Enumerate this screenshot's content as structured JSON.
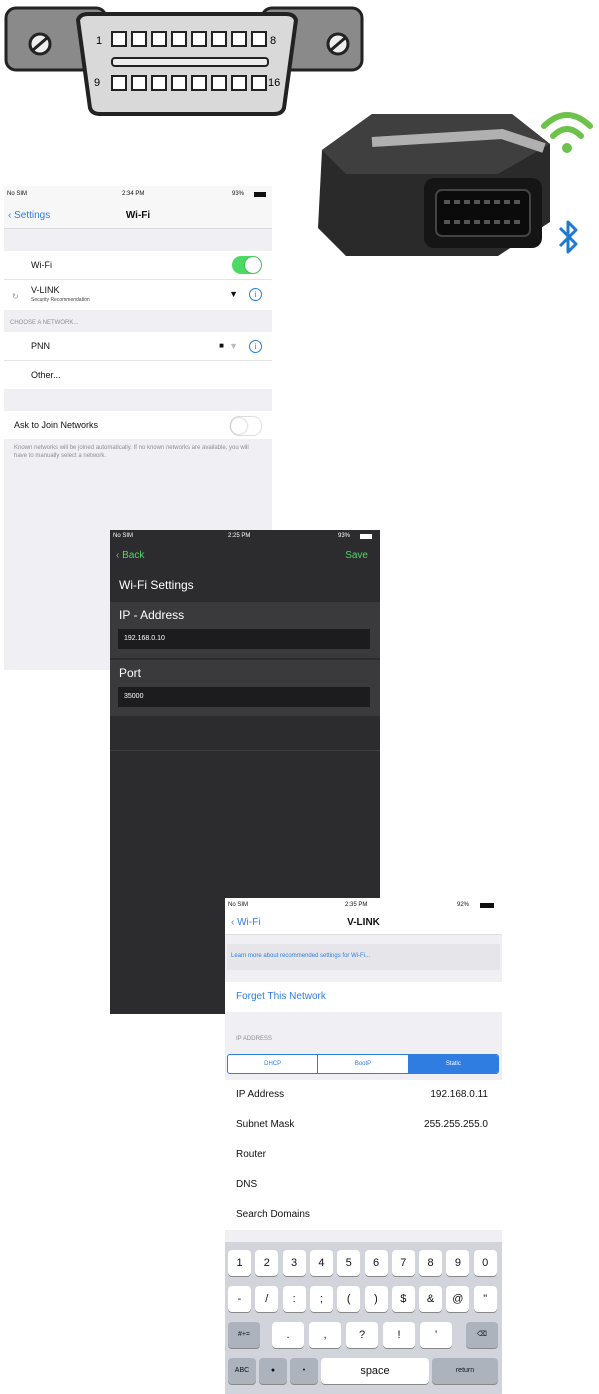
{
  "obd_port": {
    "pin_labels": {
      "p1": "1",
      "p8": "8",
      "p9": "9",
      "p16": "16"
    }
  },
  "device_icons": {
    "wifi": "wifi-icon",
    "bluetooth": "bluetooth-icon",
    "wifi_color": "#6cc24a",
    "bluetooth_color": "#1f78d1"
  },
  "screen1": {
    "status": {
      "carrier": "No SIM",
      "time": "2:34 PM",
      "battery": "93%"
    },
    "nav": {
      "back": "Settings",
      "title": "Wi-Fi"
    },
    "wifi_label": "Wi-Fi",
    "connected": {
      "name": "V-LINK",
      "subtitle": "Security Recommendation"
    },
    "section_header": "CHOOSE A NETWORK...",
    "networks": [
      {
        "name": "PNN"
      },
      {
        "name": "Other..."
      }
    ],
    "ask_label": "Ask to Join Networks",
    "ask_footer": "Known networks will be joined automatically. If no known networks are available, you will have to manually select a network.",
    "toggle_on_color": "#4cd964"
  },
  "screen2": {
    "status": {
      "carrier": "No SIM",
      "time": "2:25 PM",
      "battery": "93%"
    },
    "nav": {
      "back": "Back",
      "save": "Save"
    },
    "section_title": "Wi-Fi Settings",
    "ip_label": "IP - Address",
    "ip_value": "192.168.0.10",
    "port_label": "Port",
    "port_value": "35000"
  },
  "screen3": {
    "status": {
      "carrier": "No SIM",
      "time": "2:35 PM",
      "battery": "92%"
    },
    "nav": {
      "back": "Wi-Fi",
      "title": "V-LINK"
    },
    "learn_more": "Learn more about recommended settings for Wi-Fi...",
    "forget": "Forget This Network",
    "ip_header": "IP ADDRESS",
    "segments": [
      "DHCP",
      "BootP",
      "Static"
    ],
    "fields": [
      {
        "label": "IP Address",
        "value": "192.168.0.11"
      },
      {
        "label": "Subnet Mask",
        "value": "255.255.255.0"
      },
      {
        "label": "Router",
        "value": ""
      },
      {
        "label": "DNS",
        "value": ""
      },
      {
        "label": "Search Domains",
        "value": ""
      }
    ],
    "keyboard": {
      "row1": [
        "1",
        "2",
        "3",
        "4",
        "5",
        "6",
        "7",
        "8",
        "9",
        "0"
      ],
      "row2": [
        "-",
        "/",
        ":",
        ";",
        "(",
        ")",
        "$",
        "&",
        "@",
        "\""
      ],
      "row3_left": "#+=",
      "row3": [
        ".",
        ",",
        "?",
        "!",
        "'"
      ],
      "abc": "ABC",
      "space": "space",
      "return": "return"
    }
  }
}
